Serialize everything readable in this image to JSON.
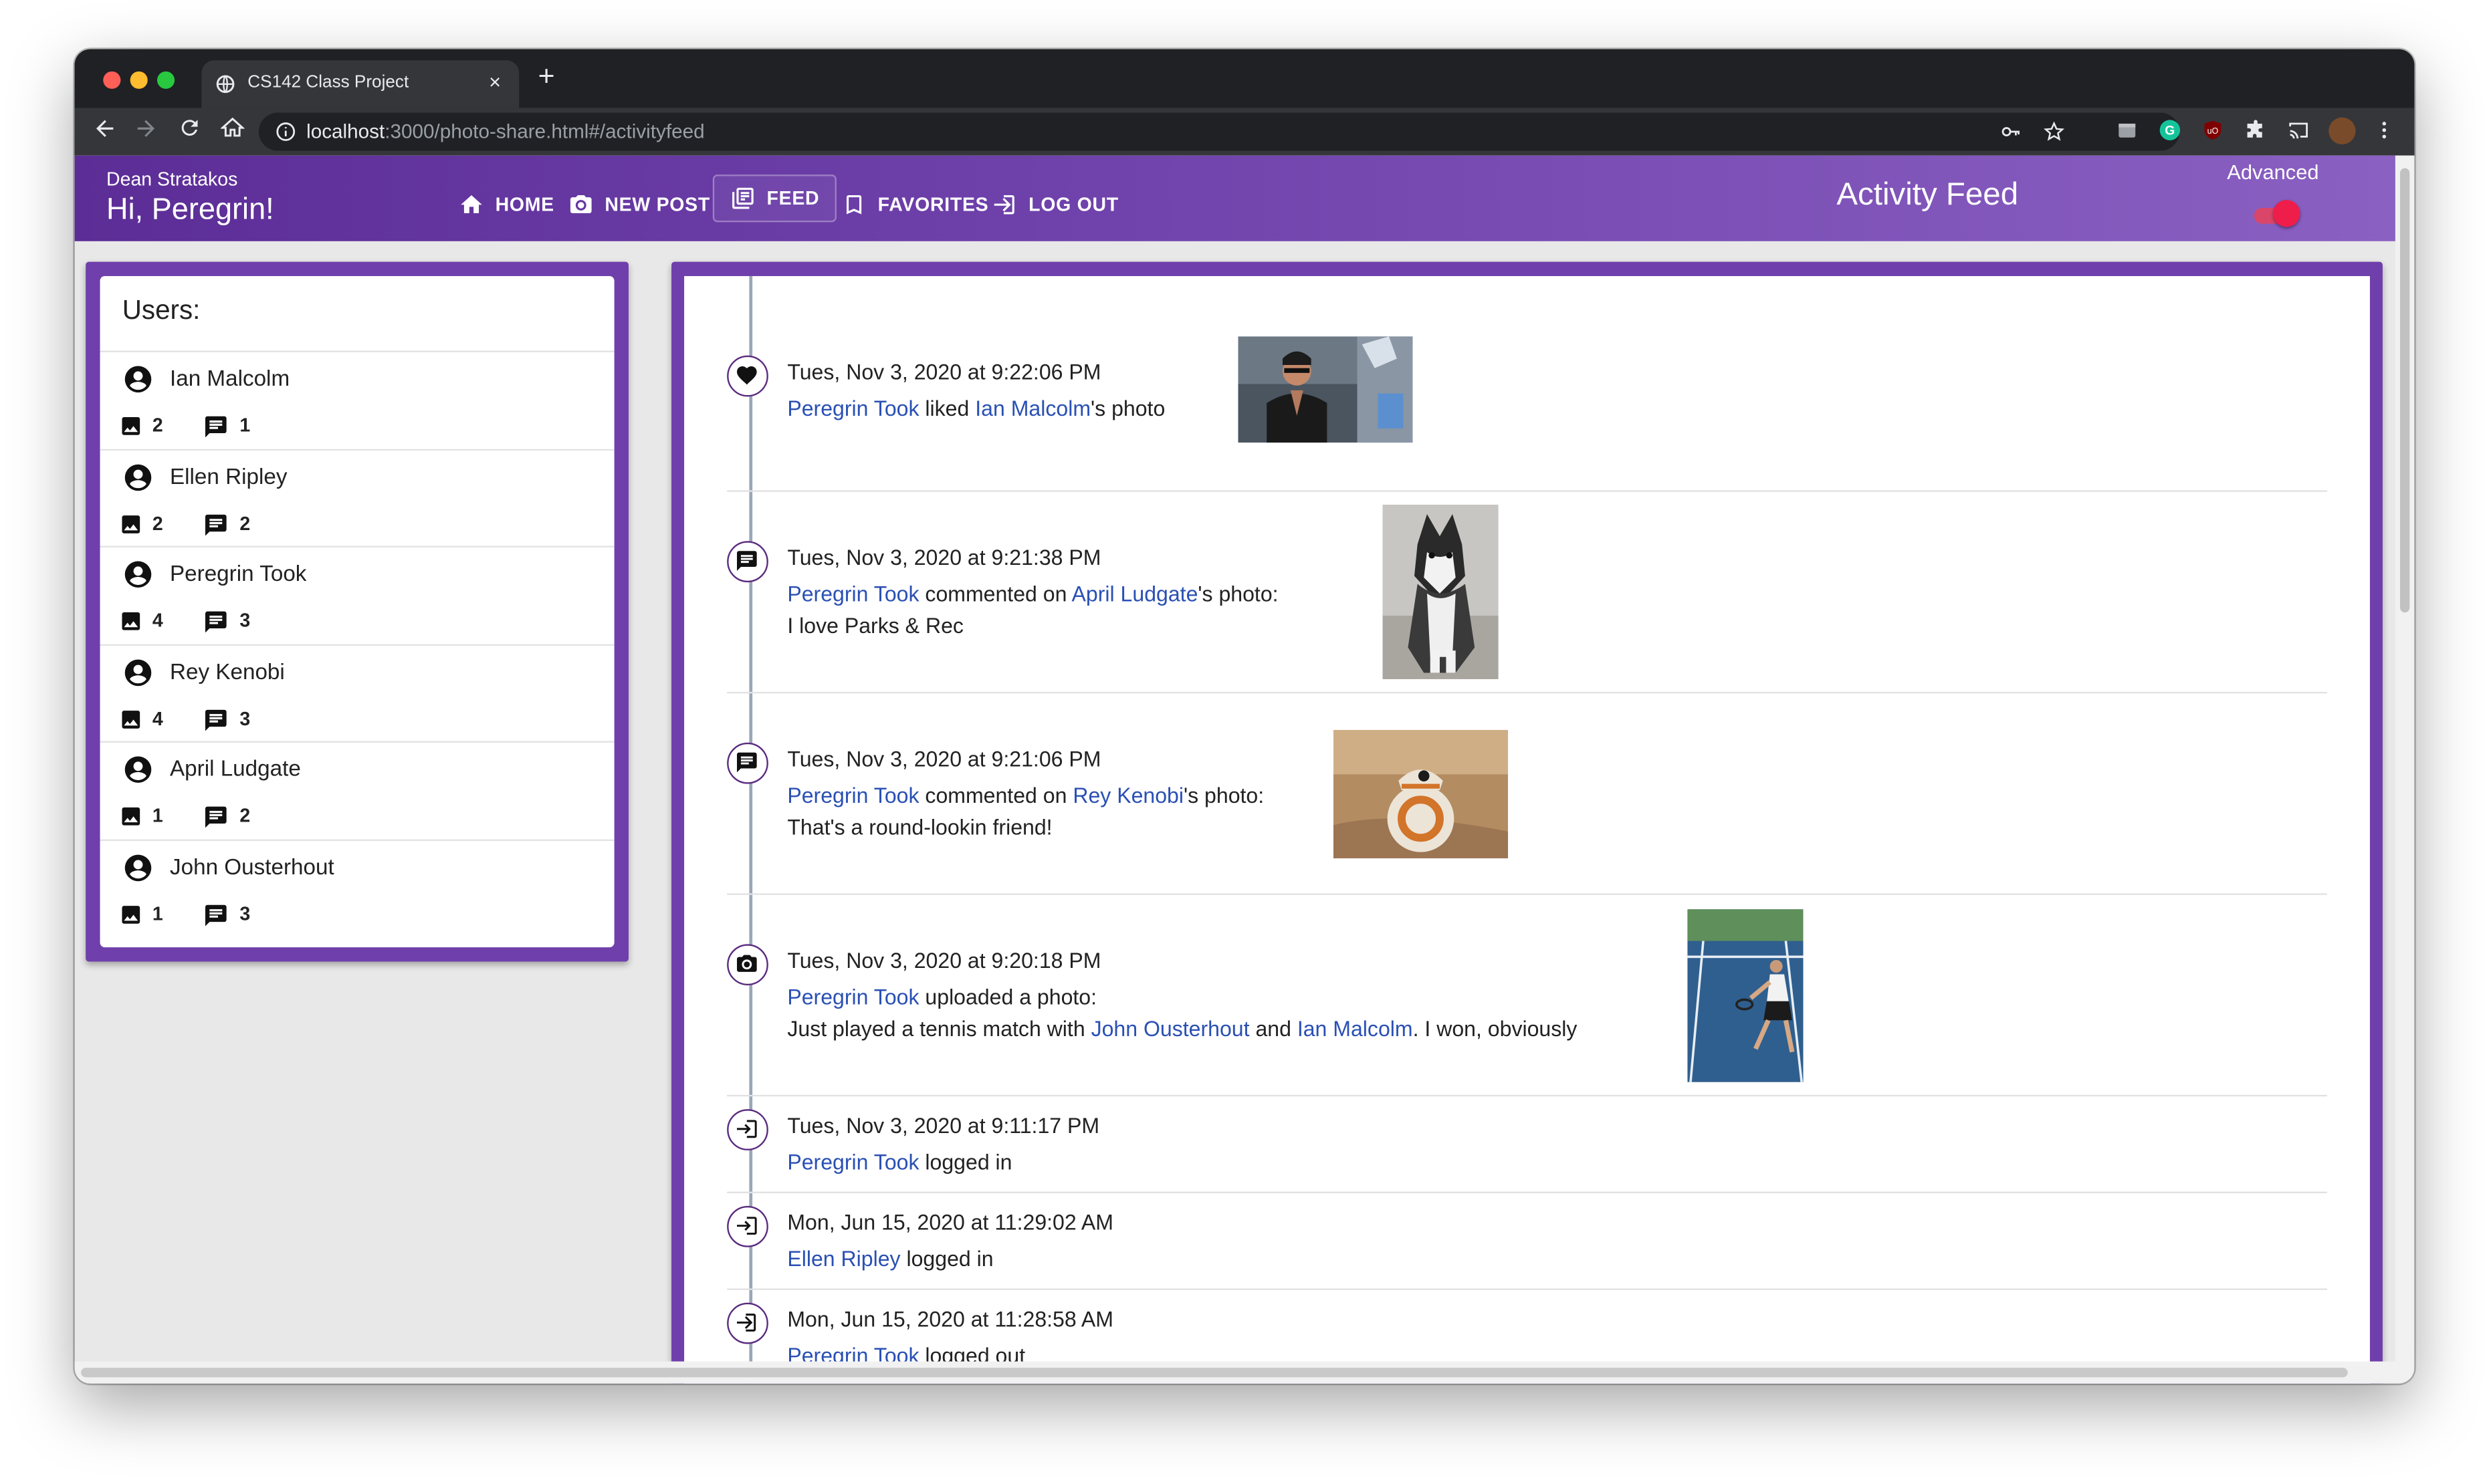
{
  "browser": {
    "tab_title": "CS142 Class Project",
    "tab_close": "×",
    "new_tab": "+",
    "url_host": "localhost",
    "url_path": ":3000/photo-share.html#/activityfeed"
  },
  "appbar": {
    "user_fullname": "Dean Stratakos",
    "greeting": "Hi, Peregrin!",
    "nav": {
      "home": "HOME",
      "new_post": "NEW POST",
      "feed": "FEED",
      "favorites": "FAVORITES",
      "log_out": "LOG OUT"
    },
    "title": "Activity Feed",
    "advanced_label": "Advanced",
    "advanced_on": true
  },
  "users_panel": {
    "header": "Users:",
    "users": [
      {
        "name": "Ian Malcolm",
        "photos": "2",
        "comments": "1"
      },
      {
        "name": "Ellen Ripley",
        "photos": "2",
        "comments": "2"
      },
      {
        "name": "Peregrin Took",
        "photos": "4",
        "comments": "3"
      },
      {
        "name": "Rey Kenobi",
        "photos": "4",
        "comments": "3"
      },
      {
        "name": "April Ludgate",
        "photos": "1",
        "comments": "2"
      },
      {
        "name": "John Ousterhout",
        "photos": "1",
        "comments": "3"
      }
    ]
  },
  "feed": [
    {
      "type": "like",
      "icon": "heart-icon",
      "time": "Tues, Nov 3, 2020 at 9:22:06 PM",
      "actor": "Peregrin Took",
      "verb": " liked ",
      "target": "Ian Malcolm",
      "suffix": "'s photo"
    },
    {
      "type": "comment",
      "icon": "comment-icon",
      "time": "Tues, Nov 3, 2020 at 9:21:38 PM",
      "actor": "Peregrin Took",
      "verb": " commented on ",
      "target": "April Ludgate",
      "suffix": "'s photo:",
      "text": "I love Parks & Rec"
    },
    {
      "type": "comment",
      "icon": "comment-icon",
      "time": "Tues, Nov 3, 2020 at 9:21:06 PM",
      "actor": "Peregrin Took",
      "verb": " commented on ",
      "target": "Rey Kenobi",
      "suffix": "'s photo:",
      "text": "That's a round-lookin friend!"
    },
    {
      "type": "upload",
      "icon": "camera-icon",
      "time": "Tues, Nov 3, 2020 at 9:20:18 PM",
      "actor": "Peregrin Took",
      "verb": " uploaded a photo:",
      "caption_pre": "Just played a tennis match with ",
      "mention1": "John Ousterhout",
      "caption_mid": " and ",
      "mention2": "Ian Malcolm",
      "caption_post": ". I won, obviously"
    },
    {
      "type": "login",
      "icon": "login-icon",
      "time": "Tues, Nov 3, 2020 at 9:11:17 PM",
      "actor": "Peregrin Took",
      "verb": " logged in"
    },
    {
      "type": "login",
      "icon": "login-icon",
      "time": "Mon, Jun 15, 2020 at 11:29:02 AM",
      "actor": "Ellen Ripley",
      "verb": " logged in"
    },
    {
      "type": "logout",
      "icon": "logout-icon",
      "time": "Mon, Jun 15, 2020 at 11:28:58 AM",
      "actor": "Peregrin Took",
      "verb": " logged out"
    }
  ],
  "colors": {
    "appbar_start": "#5c2d96",
    "appbar_end": "#8a60c2",
    "panel_border": "#6f3fab",
    "link": "#2a50b4",
    "toggle": "#ef1d4a"
  }
}
